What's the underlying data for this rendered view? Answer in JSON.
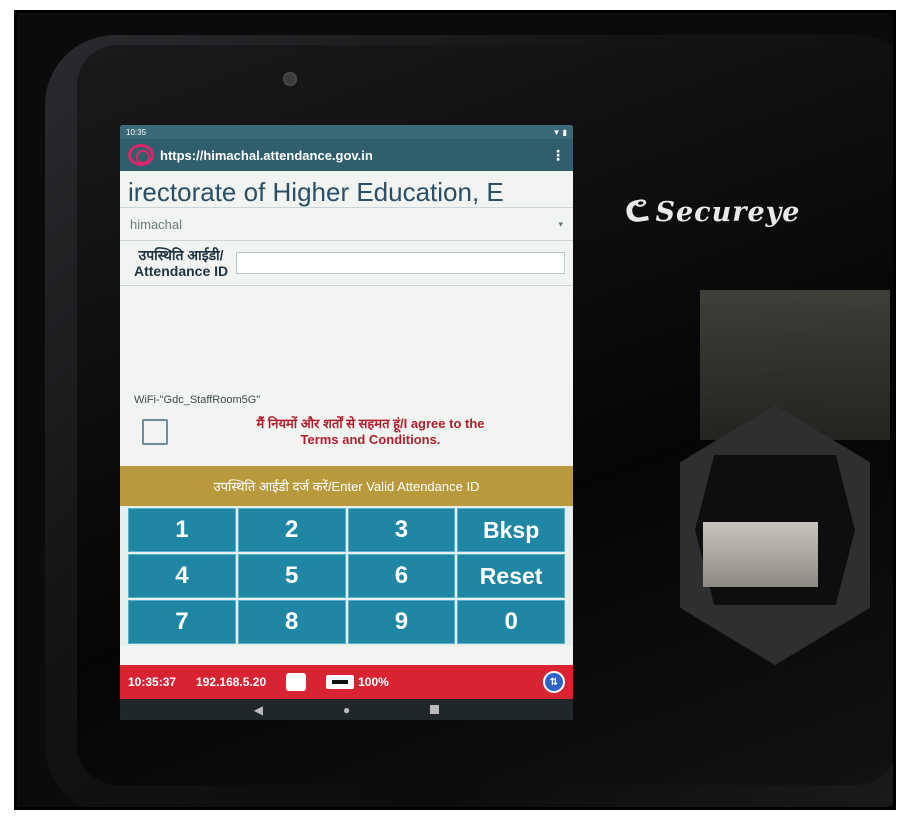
{
  "status_bar": {
    "time": "10:35",
    "right": "▼ ▮"
  },
  "browser": {
    "url": "https://himachal.attendance.gov.in",
    "menu_glyph": "⋮"
  },
  "page": {
    "title": "irectorate of Higher Education, E",
    "org_select": {
      "value": "himachal",
      "chevron": "▾"
    },
    "attendance_id": {
      "label_line1": "उपस्थिति आईडी/",
      "label_line2": "Attendance ID",
      "value": ""
    },
    "wifi": "WiFi-\"Gdc_StaffRoom5G\"",
    "agree_text_line1": "मैं नियमों और शर्तों से सहमत हूं/I agree to the",
    "agree_text_line2": "Terms and Conditions.",
    "warning": "उपस्थिति आईडी दर्ज करें/Enter Valid Attendance ID"
  },
  "keypad": {
    "k1": "1",
    "k2": "2",
    "k3": "3",
    "bksp": "Bksp",
    "k4": "4",
    "k5": "5",
    "k6": "6",
    "reset": "Reset",
    "k7": "7",
    "k8": "8",
    "k9": "9",
    "k0": "0"
  },
  "bottom_bar": {
    "clock": "10:35:37",
    "ip": "192.168.5.20",
    "battery": "100%"
  },
  "nav": {
    "back": "◀",
    "home": "●"
  },
  "device": {
    "brand": "Secureye",
    "swoosh": "ᕦ"
  },
  "colors": {
    "accent": "#1f86a4",
    "bottom_bar": "#d82333",
    "warning_bar": "#b89a3c"
  }
}
